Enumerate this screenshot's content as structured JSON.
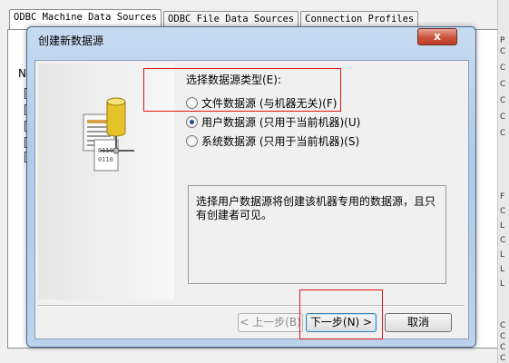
{
  "background": {
    "tabs": [
      "ODBC Machine Data Sources",
      "ODBC File Data Sources",
      "Connection Profiles"
    ],
    "list_header": "N",
    "right_strip_chars": [
      "P",
      "C",
      "C",
      "C",
      "C",
      "C",
      "C",
      "F",
      "C",
      "L",
      "C",
      "L",
      "L",
      "L",
      "C",
      "C",
      "C",
      "C"
    ]
  },
  "dialog": {
    "title": "创建新数据源",
    "close_label": "x",
    "prompt": "选择数据源类型(E):",
    "options": [
      {
        "label": "文件数据源 (与机器无关)(F)",
        "checked": false
      },
      {
        "label": "用户数据源 (只用于当前机器)(U)",
        "checked": true
      },
      {
        "label": "系统数据源 (只用于当前机器)(S)",
        "checked": false
      }
    ],
    "description": "选择用户数据源将创建该机器专用的数据源，且只有创建者可见。",
    "buttons": {
      "back": "< 上一步(B)",
      "next": "下一步(N) >",
      "cancel": "取消"
    }
  },
  "colors": {
    "annotation": "#e01818",
    "title_bar": "#bcd2ec",
    "close_button": "#c9523b"
  }
}
